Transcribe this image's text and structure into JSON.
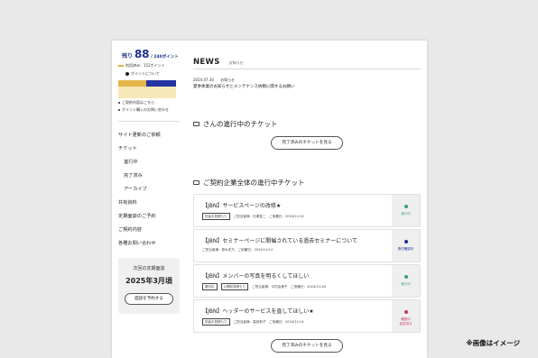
{
  "sidebar": {
    "points_prefix": "残り",
    "points_value": "88",
    "points_total": "/ 240ポイント",
    "points_used": "利用済み：152ポイント",
    "points_about": "ポイントについて",
    "contract_note": "ご契約内容はこちら",
    "purchase_note": "ポイント購入のお問い合わせ",
    "nav": [
      {
        "label": "サイト更新のご依頼",
        "sub": false
      },
      {
        "label": "チケット",
        "sub": false
      },
      {
        "label": "進行中",
        "sub": true
      },
      {
        "label": "完了済み",
        "sub": true
      },
      {
        "label": "アーカイブ",
        "sub": true
      },
      {
        "label": "共有資料",
        "sub": false
      },
      {
        "label": "定期面談のご予約",
        "sub": false
      },
      {
        "label": "ご契約内容",
        "sub": false
      },
      {
        "label": "各種お問い合わせ",
        "sub": false
      }
    ],
    "meeting": {
      "label": "次回の定期面談",
      "value": "2025年3月頃",
      "button": "面談を予約する"
    }
  },
  "main": {
    "news": {
      "title": "NEWS",
      "sub": "お知らせ",
      "date": "2024.07.30",
      "category": "お知らせ",
      "text": "夏季休業のお知らせとメンテナンス依頼に関するお願い"
    },
    "my_section": {
      "title": "さんの進行中のチケット",
      "button": "完了済みのチケットを見る"
    },
    "company_section": {
      "title": "ご契約企業全体の進行中チケット",
      "button": "完了済みのチケットを見る"
    },
    "tickets": [
      {
        "title": "【JBN】サービスページの改修★",
        "tags": [
          "別途お見積もり"
        ],
        "meta": "ご担当者様：石塚富二　ご依頼日：2024/11/14",
        "status": "進行中",
        "status_color": "#3a9a8f"
      },
      {
        "title": "【JBN】セミナーページに開催されている過去セミナーについて",
        "tags": [],
        "meta": "ご担当者様：原木史乃　ご依頼日：2024/11/14",
        "status": "受付確認中",
        "status_color": "#1d2f8f"
      },
      {
        "title": "【JBN】メンバーの写真を明るくしてほしい",
        "tags": [
          "要対応",
          "公開前見積もり"
        ],
        "meta": "ご担当者様：中村由美子　ご依頼日：2024/11/18",
        "status": "進行中",
        "status_color": "#3a9a8f"
      },
      {
        "title": "【JBN】ヘッダーのサービスを直してほしい★",
        "tags": [
          "別途お見積もり"
        ],
        "meta": "ご担当者様：高田莉子　ご依頼日：2024/11/14",
        "status": "確認中\n返答待ち",
        "status_color": "#c23a5a"
      }
    ]
  },
  "caption": "※画像はイメージ"
}
